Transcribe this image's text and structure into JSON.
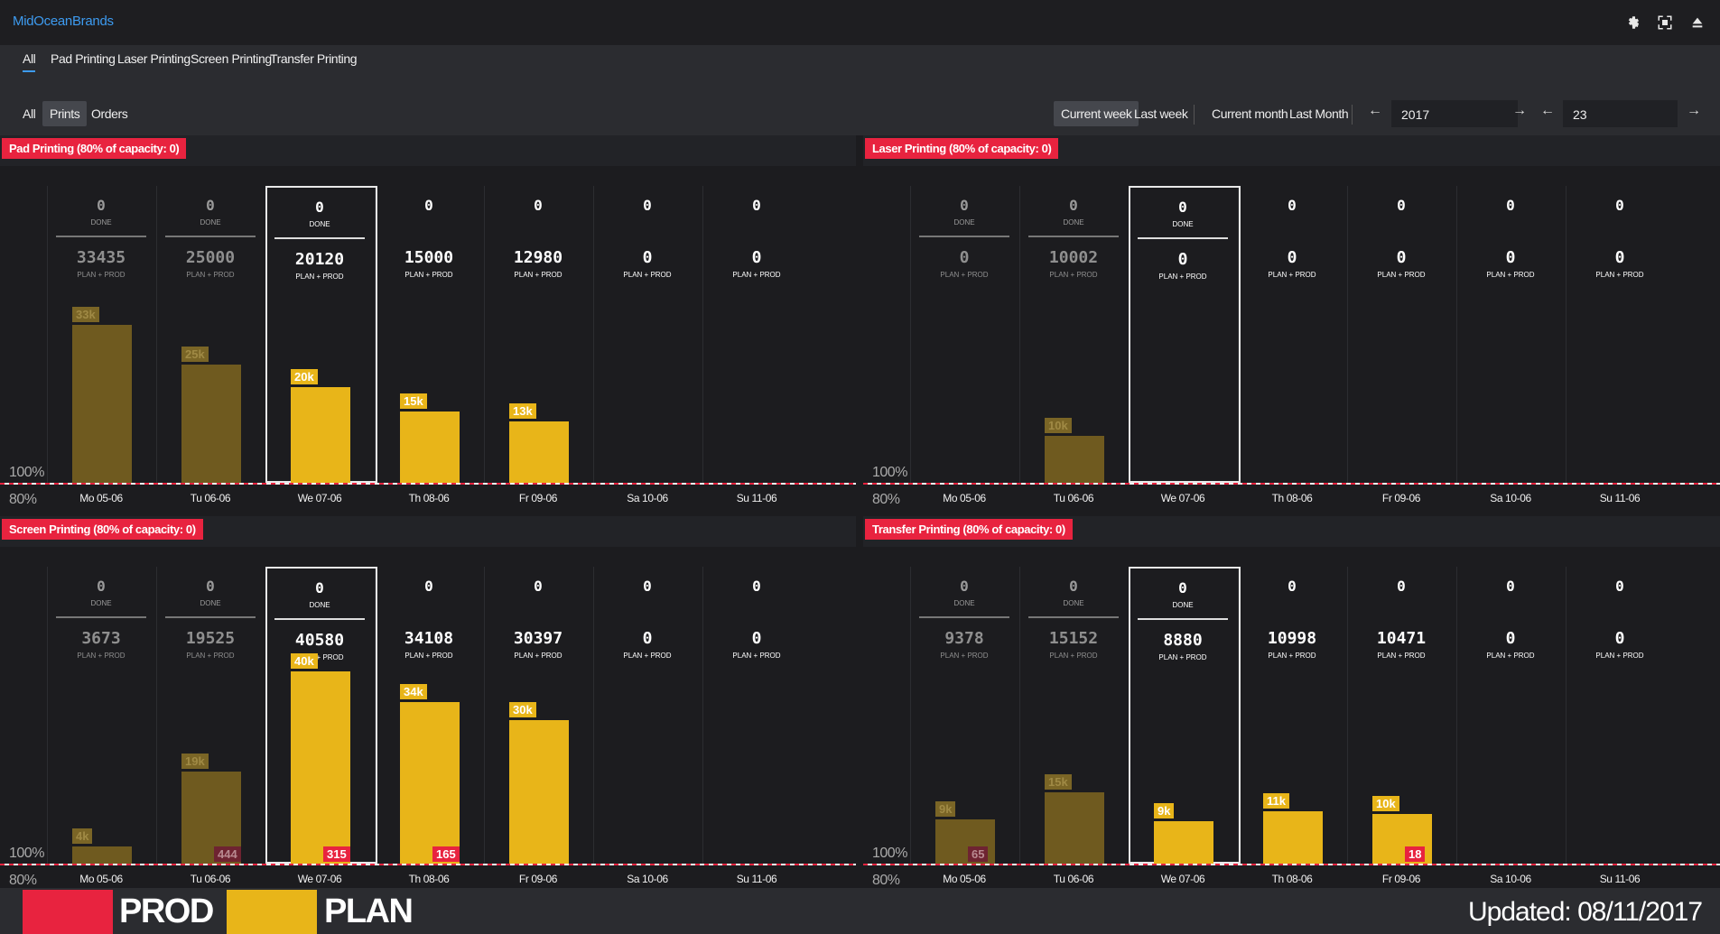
{
  "app": {
    "title": "MidOceanBrands"
  },
  "top_icons": [
    "gear-icon",
    "fullscreen-icon",
    "eject-icon"
  ],
  "main_tabs": [
    {
      "label": "All",
      "active": true
    },
    {
      "label": "Pad Printing"
    },
    {
      "label": "Laser Printing"
    },
    {
      "label": "Screen Printing"
    },
    {
      "label": "Transfer Printing"
    }
  ],
  "mode_filters": [
    {
      "label": "All"
    },
    {
      "label": "Prints",
      "active": true
    },
    {
      "label": "Orders"
    }
  ],
  "period_filters": [
    {
      "label": "Current week",
      "active": true
    },
    {
      "label": "Last week"
    },
    {
      "label": "Current month"
    },
    {
      "label": "Last Month"
    }
  ],
  "year_value": "2017",
  "week_value": "23",
  "labels": {
    "done": "DONE",
    "plan_prod": "PLAN + PROD",
    "pct100": "100%",
    "pct80": "80%"
  },
  "colors": {
    "prod": "#e8233f",
    "plan": "#e8b519",
    "plan_dim": "#6f5a1f",
    "bg": "#1c1c1f",
    "accent": "#3d9bf0"
  },
  "days": [
    "Mo 05-06",
    "Tu 06-06",
    "We 07-06",
    "Th 08-06",
    "Fr 09-06",
    "Sa 10-06",
    "Su 11-06"
  ],
  "current_day_index": 2,
  "panels": [
    {
      "title": "Pad Printing (80% of capacity: 0)",
      "done": [
        "0",
        "0",
        "0",
        "0",
        "0",
        "0",
        "0"
      ],
      "plan": [
        "33435",
        "25000",
        "20120",
        "15000",
        "12980",
        "0",
        "0"
      ],
      "bar_k": [
        "33k",
        "25k",
        "20k",
        "15k",
        "13k",
        "",
        ""
      ],
      "prod": [
        "",
        "",
        "",
        "",
        "",
        "",
        ""
      ]
    },
    {
      "title": "Laser Printing (80% of capacity: 0)",
      "done": [
        "0",
        "0",
        "0",
        "0",
        "0",
        "0",
        "0"
      ],
      "plan": [
        "0",
        "10002",
        "0",
        "0",
        "0",
        "0",
        "0"
      ],
      "bar_k": [
        "",
        "10k",
        "",
        "",
        "",
        "",
        ""
      ],
      "prod": [
        "",
        "",
        "",
        "",
        "",
        "",
        ""
      ]
    },
    {
      "title": "Screen Printing (80% of capacity: 0)",
      "done": [
        "0",
        "0",
        "0",
        "0",
        "0",
        "0",
        "0"
      ],
      "plan": [
        "3673",
        "19525",
        "40580",
        "34108",
        "30397",
        "0",
        "0"
      ],
      "bar_k": [
        "4k",
        "19k",
        "40k",
        "34k",
        "30k",
        "",
        ""
      ],
      "prod": [
        "",
        "444",
        "315",
        "165",
        "",
        "",
        ""
      ]
    },
    {
      "title": "Transfer Printing (80% of capacity: 0)",
      "done": [
        "0",
        "0",
        "0",
        "0",
        "0",
        "0",
        "0"
      ],
      "plan": [
        "9378",
        "15152",
        "8880",
        "10998",
        "10471",
        "0",
        "0"
      ],
      "bar_k": [
        "9k",
        "15k",
        "9k",
        "11k",
        "10k",
        "",
        ""
      ],
      "prod": [
        "65",
        "",
        "",
        "",
        "18",
        "",
        ""
      ]
    }
  ],
  "legend": {
    "prod": "PROD",
    "plan": "PLAN"
  },
  "updated": "Updated: 08/11/2017"
}
